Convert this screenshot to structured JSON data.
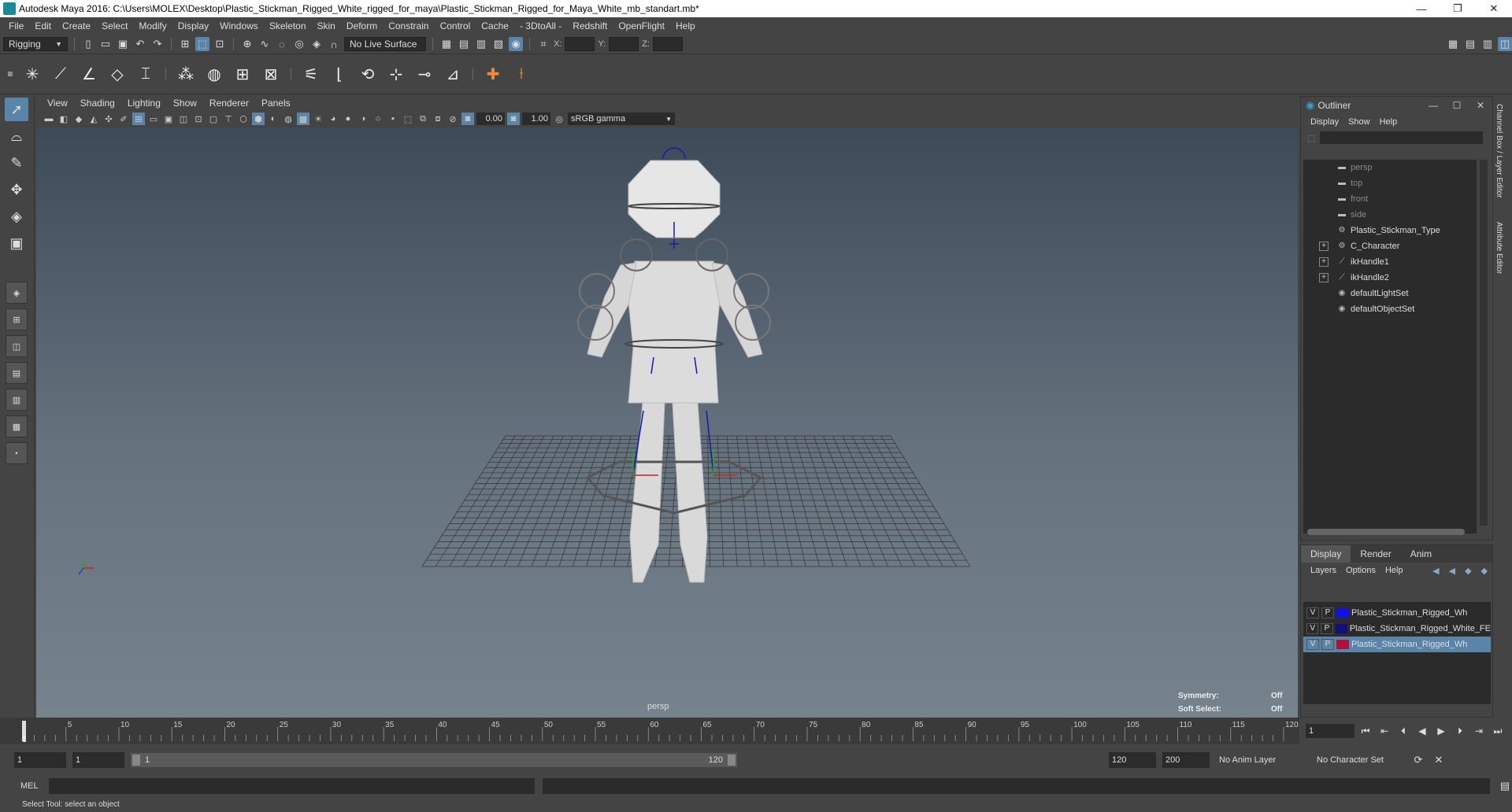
{
  "window": {
    "title": "Autodesk Maya 2016: C:\\Users\\MOLEX\\Desktop\\Plastic_Stickman_Rigged_White_rigged_for_maya\\Plastic_Stickman_Rigged_for_Maya_White_mb_standart.mb*",
    "minimize": "—",
    "restore": "❐",
    "close": "✕"
  },
  "menubar": [
    "File",
    "Edit",
    "Create",
    "Select",
    "Modify",
    "Display",
    "Windows",
    "Skeleton",
    "Skin",
    "Deform",
    "Constrain",
    "Control",
    "Cache",
    "- 3DtoAll -",
    "Redshift",
    "OpenFlight",
    "Help"
  ],
  "statusline": {
    "menuset": "Rigging",
    "live_surface": "No Live Surface",
    "x_label": "X:",
    "y_label": "Y:",
    "z_label": "Z:"
  },
  "panel": {
    "menus": [
      "View",
      "Shading",
      "Lighting",
      "Show",
      "Renderer",
      "Panels"
    ],
    "exposure": "0.00",
    "gamma": "1.00",
    "color_space": "sRGB gamma"
  },
  "viewport": {
    "camera": "persp",
    "symmetry_label": "Symmetry:",
    "symmetry_value": "Off",
    "soft_select_label": "Soft Select:",
    "soft_select_value": "Off",
    "colors": {
      "grid": "#333333",
      "body": "#d9d9d9",
      "joint": "#1a1aaa",
      "axis_x": "#cc2222",
      "axis_y": "#22aa22"
    }
  },
  "outliner": {
    "title": "Outliner",
    "menus": [
      "Display",
      "Show",
      "Help"
    ],
    "items": [
      {
        "label": "persp",
        "icon": "camera-icon",
        "expandable": false,
        "dim": true
      },
      {
        "label": "top",
        "icon": "camera-icon",
        "expandable": false,
        "dim": true
      },
      {
        "label": "front",
        "icon": "camera-icon",
        "expandable": false,
        "dim": true
      },
      {
        "label": "side",
        "icon": "camera-icon",
        "expandable": false,
        "dim": true
      },
      {
        "label": "Plastic_Stickman_Type",
        "icon": "transform-icon",
        "expandable": false,
        "dim": false
      },
      {
        "label": "C_Character",
        "icon": "transform-icon",
        "expandable": true,
        "dim": false
      },
      {
        "label": "ikHandle1",
        "icon": "ik-handle-icon",
        "expandable": true,
        "dim": false
      },
      {
        "label": "ikHandle2",
        "icon": "ik-handle-icon",
        "expandable": true,
        "dim": false
      },
      {
        "label": "defaultLightSet",
        "icon": "set-icon",
        "expandable": false,
        "dim": false
      },
      {
        "label": "defaultObjectSet",
        "icon": "set-icon",
        "expandable": false,
        "dim": false
      }
    ]
  },
  "side_tabs": [
    "Channel Box / Layer Editor",
    "Attribute Editor"
  ],
  "layer_editor": {
    "tabs": [
      "Display",
      "Render",
      "Anim"
    ],
    "menus": [
      "Layers",
      "Options",
      "Help"
    ],
    "layers": [
      {
        "v": "V",
        "p": "P",
        "color": "#1010ee",
        "name": "Plastic_Stickman_Rigged_Wh",
        "selected": false
      },
      {
        "v": "V",
        "p": "P",
        "color": "#101080",
        "name": "Plastic_Stickman_Rigged_White_FE",
        "selected": false
      },
      {
        "v": "V",
        "p": "P",
        "color": "#b01040",
        "name": "Plastic_Stickman_Rigged_Wh",
        "selected": true
      }
    ]
  },
  "timeslider": {
    "ticks": [
      "5",
      "10",
      "15",
      "20",
      "25",
      "30",
      "35",
      "40",
      "45",
      "50",
      "55",
      "60",
      "65",
      "70",
      "75",
      "80",
      "85",
      "90",
      "95",
      "100",
      "105",
      "110",
      "115",
      "120"
    ],
    "current_frame_marker": "1",
    "current_frame": "1"
  },
  "range": {
    "start": "1",
    "playback_start": "1",
    "range_start_label": "1",
    "range_end_label": "120",
    "playback_end": "120",
    "end": "200",
    "anim_layer": "No Anim Layer",
    "character_set": "No Character Set"
  },
  "cmdline": {
    "language": "MEL"
  },
  "helpline": {
    "text": "Select Tool: select an object"
  }
}
